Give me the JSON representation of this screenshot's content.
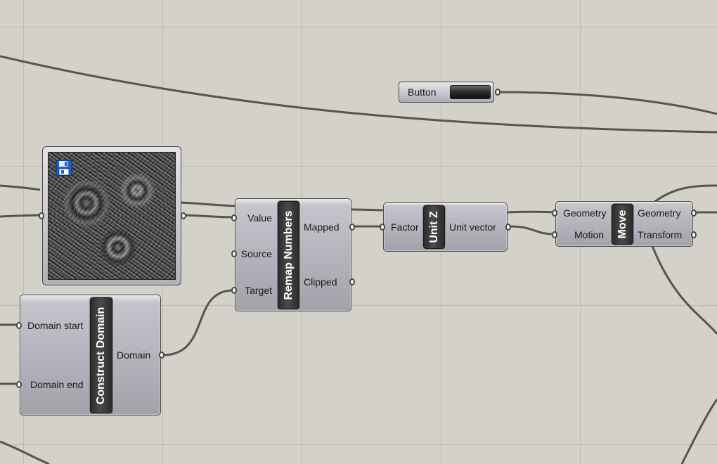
{
  "button_param": {
    "label": "Button"
  },
  "image_param": {
    "icon": "save-icon"
  },
  "remap": {
    "title": "Remap Numbers",
    "inputs": [
      "Value",
      "Source",
      "Target"
    ],
    "outputs": [
      "Mapped",
      "Clipped"
    ]
  },
  "unit_z": {
    "title": "Unit Z",
    "inputs": [
      "Factor"
    ],
    "outputs": [
      "Unit vector"
    ]
  },
  "move": {
    "title": "Move",
    "inputs": [
      "Geometry",
      "Motion"
    ],
    "outputs": [
      "Geometry",
      "Transform"
    ]
  },
  "construct_domain": {
    "title": "Construct Domain",
    "inputs": [
      "Domain start",
      "Domain end"
    ],
    "outputs": [
      "Domain"
    ]
  },
  "colors": {
    "canvas": "#d4d1c8",
    "grid": "#bdbab2",
    "wire": "#55554f",
    "component_core": "#3a3a3a"
  }
}
